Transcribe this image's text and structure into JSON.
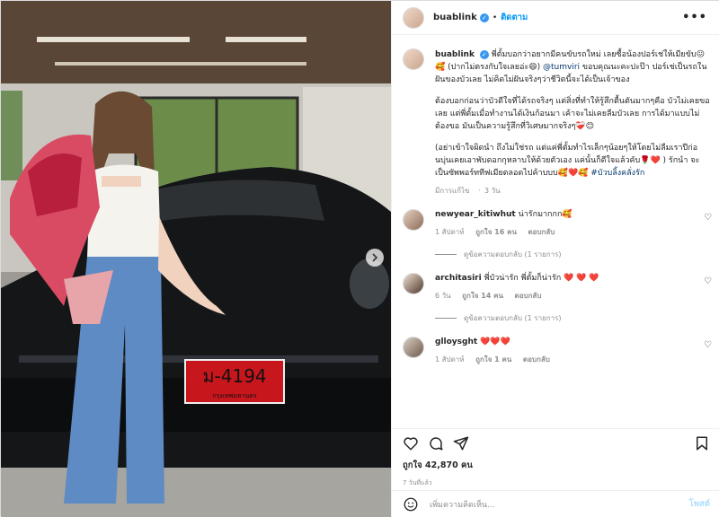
{
  "post": {
    "username": "buablink",
    "follow_label": "ติดตาม",
    "more_label": "•••",
    "plate_text": "ม-4194",
    "plate_province": "กรุงเทพมหานคร",
    "caption": {
      "username": "buablink",
      "p1_a": "พี่ตั้มบอกว่าอยากมีคนขับรถใหม่ เลยซื้อน้องปอร์เช่ให้เมียขับ😖🥰 (ปากไม่ตรงกับใจเลยอ่ะ😄) ",
      "p1_mention": "@tumviri",
      "p1_b": " ขอบคุณนะคะปะป๊า ปอร์เช่เป็นรถในฝันของบัวเลย ไม่คิดไม่ฝันจริงๆว่าชีวิตนี้จะได้เป็นเจ้าของ",
      "p2": "ต้องบอกก่อนว่าบัวดีใจที่ได้รถจริงๆ แต่สิ่งที่ทำให้รู้สึกตื้นตันมากๆคือ บัวไม่เคยขอเลย แต่พี่ตั้มเมื่อทำงานได้เงินก้อนมา เค้าจะไม่เคยลืมบัวเลย การได้มาแบบไม่ต้องขอ มันเป็นความรู้สึกที่วิเศษมากจริงๆ❤️‍🩹😊",
      "p3_a": "(อย่าเข้าใจผิดนำ ถึงไม่ใช่รถ แต่แค่พี่ตั้มทำไรเล็กๆน้อยๆให้โดยไม่ลืมเราปีก่อนบุ่นเคยเอาพับดอกกุหลาบให้ด้วยตัวเอง แค่นั้นก็ดีใจแล้วคับ🌹❤️ ) รักนำ จะเป็นซัพพอร์ททีฟเมียตลอดไปค้าบบบ🥰❤️🥰 ",
      "p3_hashtag": "#บัวบลิ้งคลั่งรัก",
      "translate": "มีการแก้ไข",
      "age": "3 วัน"
    },
    "comments": [
      {
        "username": "newyear_kitiwhut",
        "text": "น่ารักมากกก🥰",
        "age": "1 สัปดาห์",
        "likes": "ถูกใจ 16 คน",
        "reply": "ตอบกลับ",
        "view_replies": "ดูข้อความตอบกลับ (1 รายการ)"
      },
      {
        "username": "architasiri",
        "text": "พี่บัวน่ารัก พี่ตั้มก็น่ารัก ❤️ ❤️ ❤️",
        "age": "6 วัน",
        "likes": "ถูกใจ 14 คน",
        "reply": "ตอบกลับ",
        "view_replies": "ดูข้อความตอบกลับ (1 รายการ)"
      },
      {
        "username": "glloysght",
        "text": "❤️❤️❤️",
        "age": "1 สัปดาห์",
        "likes": "ถูกใจ 1 คน",
        "reply": "ตอบกลับ",
        "view_replies": ""
      }
    ],
    "likes_label": "ถูกใจ 42,870 คน",
    "timestamp": "7 วันที่แล้ว",
    "comment_placeholder": "เพิ่มความคิดเห็น...",
    "post_button": "โพสต์"
  },
  "colors": {
    "accent": "#0095f6",
    "plate": "#c8161d",
    "verified": "#3897f0"
  },
  "icons": [
    "heart-icon",
    "comment-icon",
    "share-icon",
    "bookmark-icon",
    "emoji-icon",
    "more-icon",
    "chevron-right-icon",
    "verified-badge-icon"
  ]
}
